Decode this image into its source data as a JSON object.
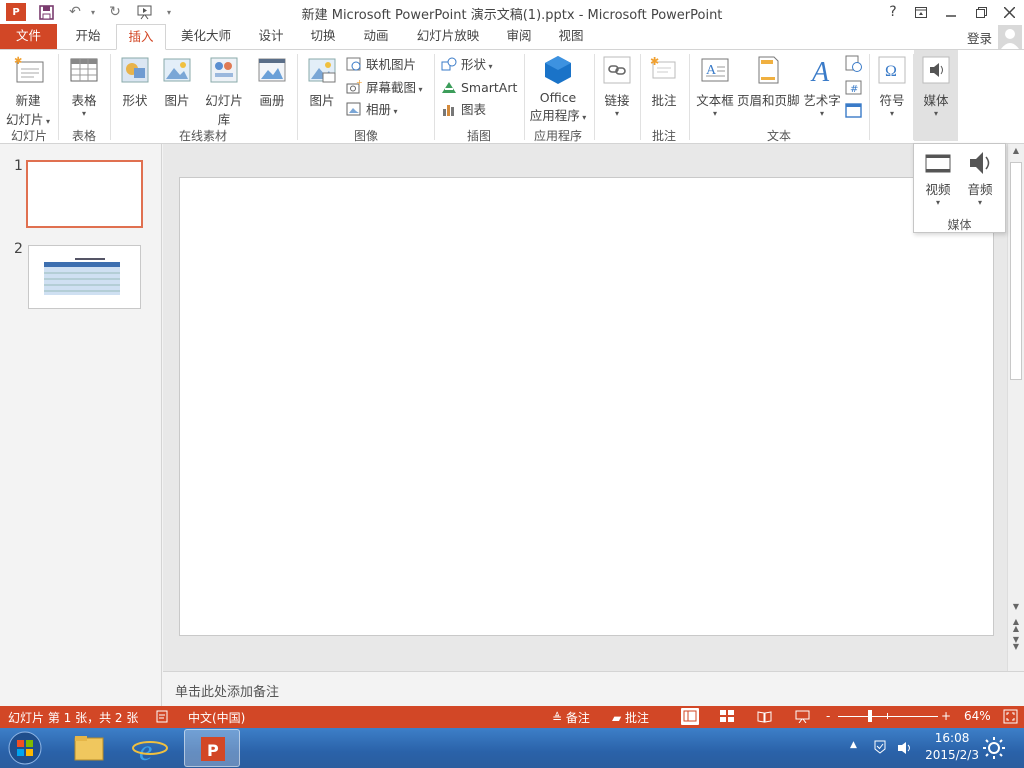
{
  "window": {
    "title": "新建 Microsoft PowerPoint 演示文稿(1).pptx - Microsoft PowerPoint",
    "help": "?",
    "controls": [
      "restore-ribbon",
      "minimize",
      "maximize",
      "close"
    ]
  },
  "tabs": [
    "文件",
    "开始",
    "插入",
    "美化大师",
    "设计",
    "切换",
    "动画",
    "幻灯片放映",
    "审阅",
    "视图"
  ],
  "active_tab": "插入",
  "account": {
    "login": "登录"
  },
  "ribbon": {
    "groups": {
      "slides": {
        "label": "幻灯片",
        "new_slide_line1": "新建",
        "new_slide_line2": "幻灯片"
      },
      "tables": {
        "label": "表格",
        "table": "表格"
      },
      "online": {
        "label": "在线素材",
        "shapes": "形状",
        "pictures": "图片",
        "slide_library": "幻灯片库",
        "album": "画册"
      },
      "images": {
        "label": "图像",
        "picture": "图片",
        "online_pictures": "联机图片",
        "screenshot": "屏幕截图",
        "photo_album": "相册"
      },
      "illustrations": {
        "label": "插图",
        "shapes": "形状",
        "smartart": "SmartArt",
        "chart": "图表"
      },
      "apps": {
        "label": "应用程序",
        "office_line1": "Office",
        "office_line2": "应用程序"
      },
      "links": {
        "link": "链接"
      },
      "comments": {
        "label": "批注",
        "comment": "批注"
      },
      "text": {
        "label": "文本",
        "textbox": "文本框",
        "header_footer": "页眉和页脚",
        "wordart": "艺术字"
      },
      "symbols": {
        "symbol": "符号"
      },
      "media": {
        "media": "媒体"
      }
    }
  },
  "media_popup": {
    "video": "视频",
    "audio": "音频",
    "group_label": "媒体"
  },
  "thumbnails": [
    {
      "number": "1"
    },
    {
      "number": "2"
    }
  ],
  "notes": {
    "placeholder": "单击此处添加备注"
  },
  "statusbar": {
    "slide_info": "幻灯片 第 1 张，共 2 张",
    "language": "中文(中国)",
    "notes": "备注",
    "comments": "批注",
    "zoom_minus": "-",
    "zoom_plus": "+",
    "zoom": "64%",
    "zoom_level": 0.64
  },
  "taskbar": {
    "time": "16:08",
    "date": "2015/2/3"
  },
  "colors": {
    "accent": "#d24726",
    "taskbar": "#2a62a9"
  }
}
